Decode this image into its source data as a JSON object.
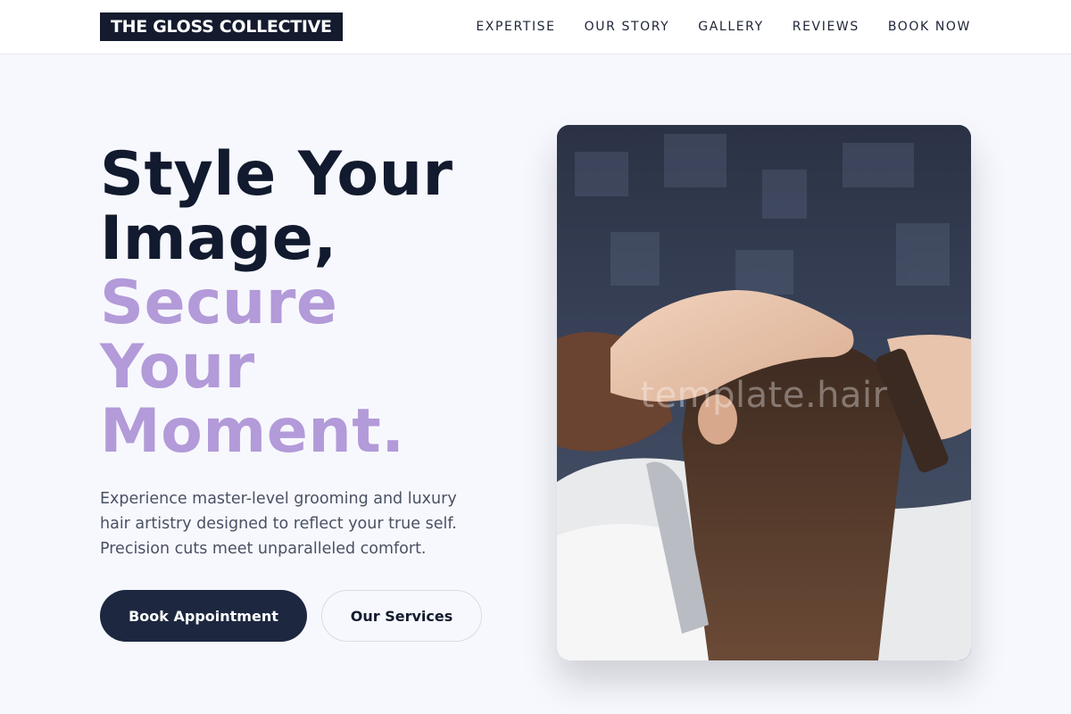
{
  "header": {
    "logo": "THE GLOSS COLLECTIVE",
    "nav": [
      "EXPERTISE",
      "OUR STORY",
      "GALLERY",
      "REVIEWS",
      "BOOK NOW"
    ]
  },
  "hero": {
    "headline_dark": [
      "Style Your",
      "Image,"
    ],
    "headline_accent": [
      "Secure",
      "Your",
      "Moment."
    ],
    "description": "Experience master-level grooming and luxury hair artistry designed to reflect your true self. Precision cuts meet unparalleled comfort.",
    "primary_button": "Book Appointment",
    "secondary_button": "Our Services",
    "image_watermark": "template.hair"
  },
  "colors": {
    "brand_dark": "#141b2e",
    "accent_lavender": "#b39ad9",
    "background": "#f7f8fd"
  }
}
